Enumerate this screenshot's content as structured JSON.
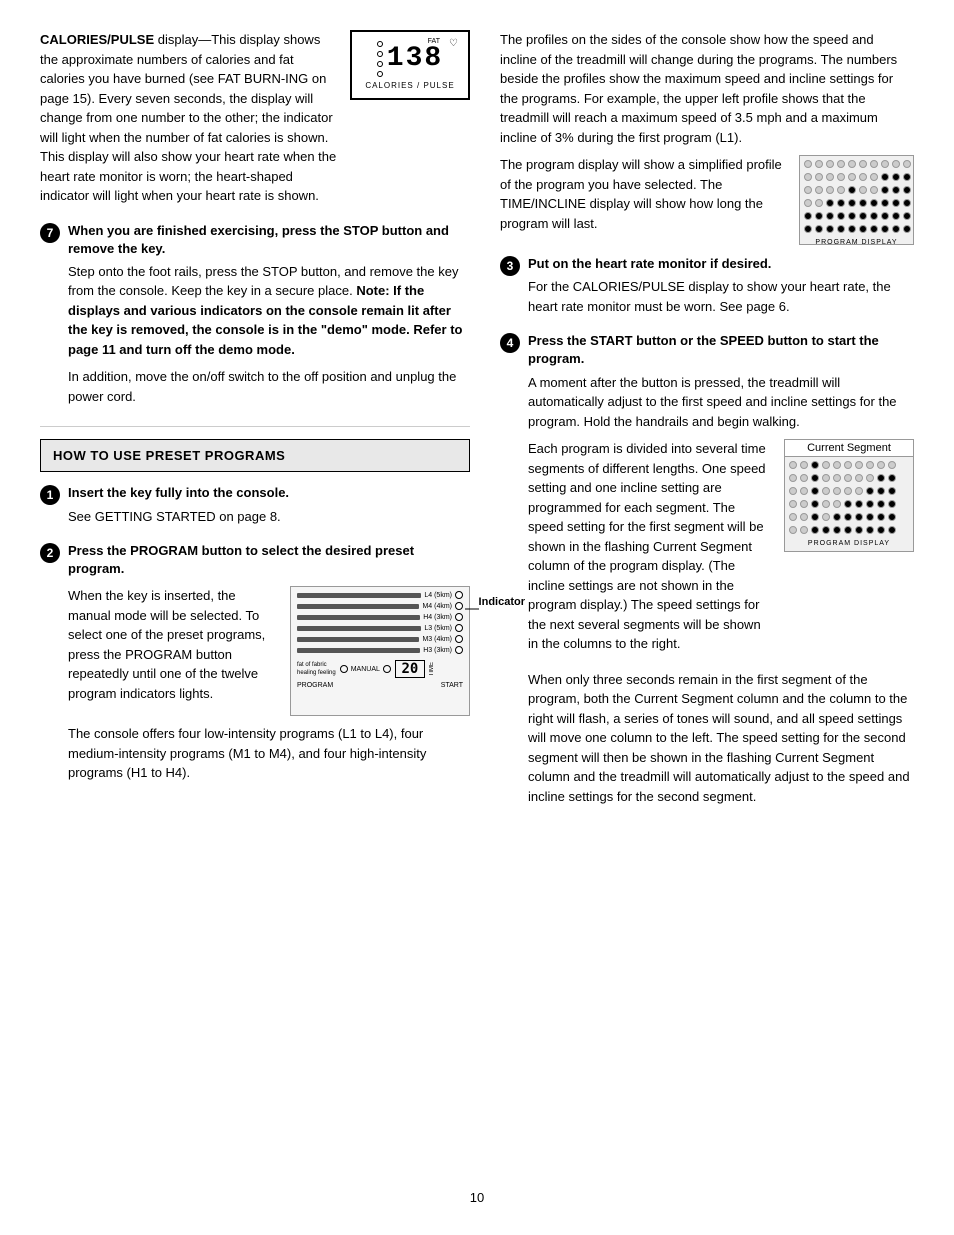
{
  "left": {
    "calories_heading": "CALORIES/PULSE",
    "calories_display": "138",
    "calories_label": "CALORIES / PULSE",
    "calories_text1": "display—This display shows the approximate numbers of calories and fat calories you have burned (see FAT BURN-ING on page 15). Every seven seconds, the display will change from one number to the other; the indicator will light when the number of fat calories is shown. This display will also show your heart rate when the heart rate monitor is worn; the heart-shaped indicator will light when your heart rate is shown.",
    "step7_heading": "When you are finished exercising, press the STOP button and remove the key.",
    "step7_text1": "Step onto the foot rails, press the STOP button, and remove the key from the console. Keep the key in a secure place.",
    "step7_bold": "Note: If the displays and various indicators on the console remain lit after the key is removed, the console is in the \"demo\" mode. Refer to page 11 and turn off the demo mode.",
    "step7_text2": "In addition, move the on/off switch to the off position and unplug the power cord.",
    "preset_heading": "HOW TO USE PRESET PROGRAMS",
    "step1_heading": "Insert the key fully into the console.",
    "step1_text": "See GETTING STARTED on page 8.",
    "step2_heading": "Press the PROGRAM button to select the desired preset program.",
    "step2_text1": "When the key is inserted, the manual mode will be selected. To select one of the preset programs, press the PROGRAM button repeatedly until one of the twelve program indicators lights.",
    "step2_indicator_label": "Indicator",
    "step2_text2": "The console offers four low-intensity programs (L1 to L4), four medium-intensity programs (M1 to M4), and four high-intensity programs (H1 to H4)."
  },
  "right": {
    "para1": "The profiles on the sides of the console show how the speed and incline of the treadmill will change during the programs. The numbers beside the profiles show the maximum speed and incline settings for the programs. For example, the upper left profile shows that the treadmill will reach a maximum speed of 3.5 mph and a maximum incline of 3% during the first program (L1).",
    "para2": "The program display will show a simplified profile of the program you have selected. The TIME/INCLINE display will show how long the program will last.",
    "program_display_label": "PROGRAM DISPLAY",
    "step3_heading": "Put on the heart rate monitor if desired.",
    "step3_text": "For the CALORIES/PULSE display to show your heart rate, the heart rate monitor must be worn. See page 6.",
    "step4_heading": "Press the START button or the SPEED      button to start the program.",
    "step4_text1": "A moment after the button is pressed, the treadmill will automatically adjust to the first speed and incline settings for the program. Hold the handrails and begin walking.",
    "current_segment_label": "Current Segment",
    "program_display_label2": "PROGRAM DISPLAY",
    "para3": "Each program is divided into several time segments of different lengths. One speed setting and one incline setting are programmed for each segment. The speed setting for the first segment will be shown in the flashing Current Segment column of the program display. (The incline settings are not shown in the program display.) The speed settings for the next several segments will be shown in the columns to the right.",
    "para4": "When only three seconds remain in the first segment of the program, both the Current Segment column and the column to the right will flash, a series of tones will sound, and all speed settings will move one column to the left. The speed setting for the second segment will then be shown in the flashing Current Segment column and the treadmill will automatically adjust to the speed and incline settings for the second segment."
  },
  "page_number": "10"
}
